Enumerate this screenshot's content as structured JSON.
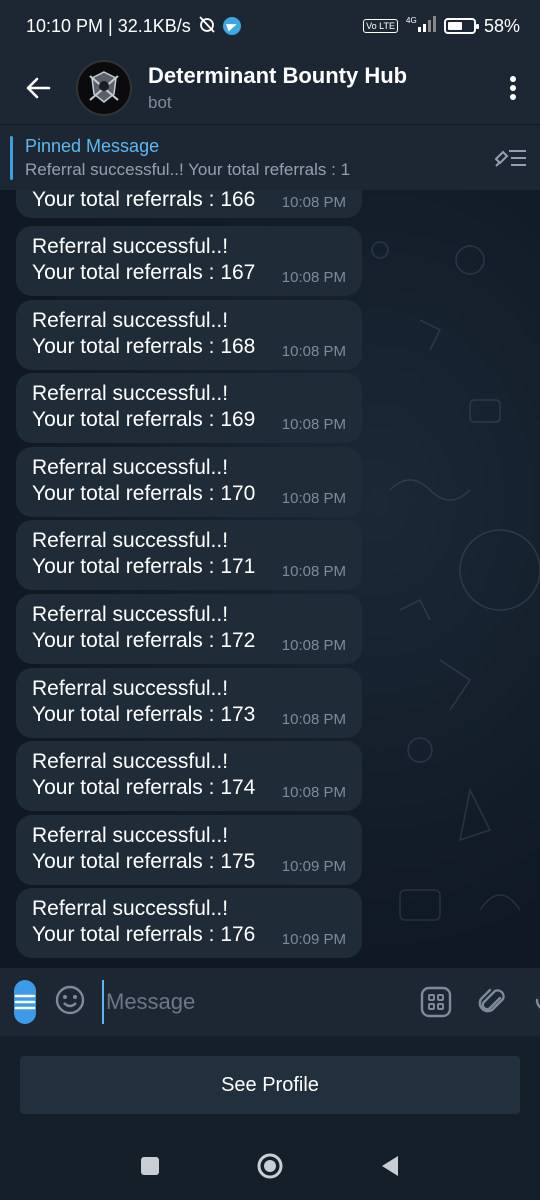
{
  "status_bar": {
    "time_speed": "10:10 PM | 32.1KB/s",
    "network_label": "4G",
    "volte_label": "Vo LTE",
    "battery": "58%",
    "battery_level": 0.58
  },
  "header": {
    "title": "Determinant Bounty Hub",
    "subtitle": "bot"
  },
  "pinned": {
    "title": "Pinned Message",
    "message": "Referral successful..! Your total referrals : 1"
  },
  "messages": [
    {
      "line1": "",
      "line2": "Your total referrals : 166",
      "time": "10:08 PM"
    },
    {
      "line1": "Referral successful..!",
      "line2": "Your total referrals : 167",
      "time": "10:08 PM"
    },
    {
      "line1": "Referral successful..!",
      "line2": "Your total referrals : 168",
      "time": "10:08 PM"
    },
    {
      "line1": "Referral successful..!",
      "line2": "Your total referrals : 169",
      "time": "10:08 PM"
    },
    {
      "line1": "Referral successful..!",
      "line2": "Your total referrals : 170",
      "time": "10:08 PM"
    },
    {
      "line1": "Referral successful..!",
      "line2": "Your total referrals : 171",
      "time": "10:08 PM"
    },
    {
      "line1": "Referral successful..!",
      "line2": "Your total referrals : 172",
      "time": "10:08 PM"
    },
    {
      "line1": "Referral successful..!",
      "line2": "Your total referrals : 173",
      "time": "10:08 PM"
    },
    {
      "line1": "Referral successful..!",
      "line2": "Your total referrals : 174",
      "time": "10:08 PM"
    },
    {
      "line1": "Referral successful..!",
      "line2": "Your total referrals : 175",
      "time": "10:09 PM"
    },
    {
      "line1": "Referral successful..!",
      "line2": "Your total referrals : 176",
      "time": "10:09 PM"
    }
  ],
  "input": {
    "placeholder": "Message"
  },
  "profile_button": "See Profile",
  "colors": {
    "accent": "#3d9ae6",
    "header_bg": "#1d2733",
    "bubble_bg": "#1f2b37",
    "chat_bg": "#0e1621"
  }
}
